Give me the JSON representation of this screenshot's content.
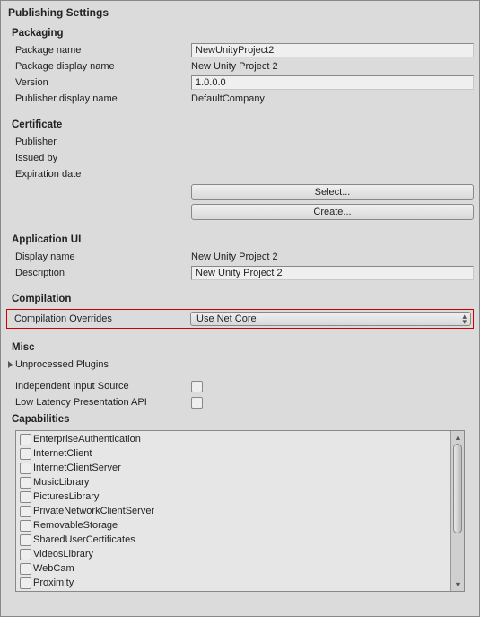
{
  "title": "Publishing Settings",
  "packaging": {
    "heading": "Packaging",
    "package_name_label": "Package name",
    "package_name_value": "NewUnityProject2",
    "package_display_label": "Package display name",
    "package_display_value": "New Unity Project 2",
    "version_label": "Version",
    "version_value": "1.0.0.0",
    "publisher_display_label": "Publisher display name",
    "publisher_display_value": "DefaultCompany"
  },
  "certificate": {
    "heading": "Certificate",
    "publisher_label": "Publisher",
    "issued_by_label": "Issued by",
    "expiration_label": "Expiration date",
    "select_btn": "Select...",
    "create_btn": "Create..."
  },
  "app_ui": {
    "heading": "Application UI",
    "display_name_label": "Display name",
    "display_name_value": "New Unity Project 2",
    "description_label": "Description",
    "description_value": "New Unity Project 2"
  },
  "compilation": {
    "heading": "Compilation",
    "overrides_label": "Compilation Overrides",
    "overrides_value": "Use Net Core"
  },
  "misc": {
    "heading": "Misc",
    "unprocessed_plugins_label": "Unprocessed Plugins",
    "independent_input_label": "Independent Input Source",
    "low_latency_label": "Low Latency Presentation API"
  },
  "capabilities": {
    "heading": "Capabilities",
    "items": [
      "EnterpriseAuthentication",
      "InternetClient",
      "InternetClientServer",
      "MusicLibrary",
      "PicturesLibrary",
      "PrivateNetworkClientServer",
      "RemovableStorage",
      "SharedUserCertificates",
      "VideosLibrary",
      "WebCam",
      "Proximity"
    ]
  }
}
